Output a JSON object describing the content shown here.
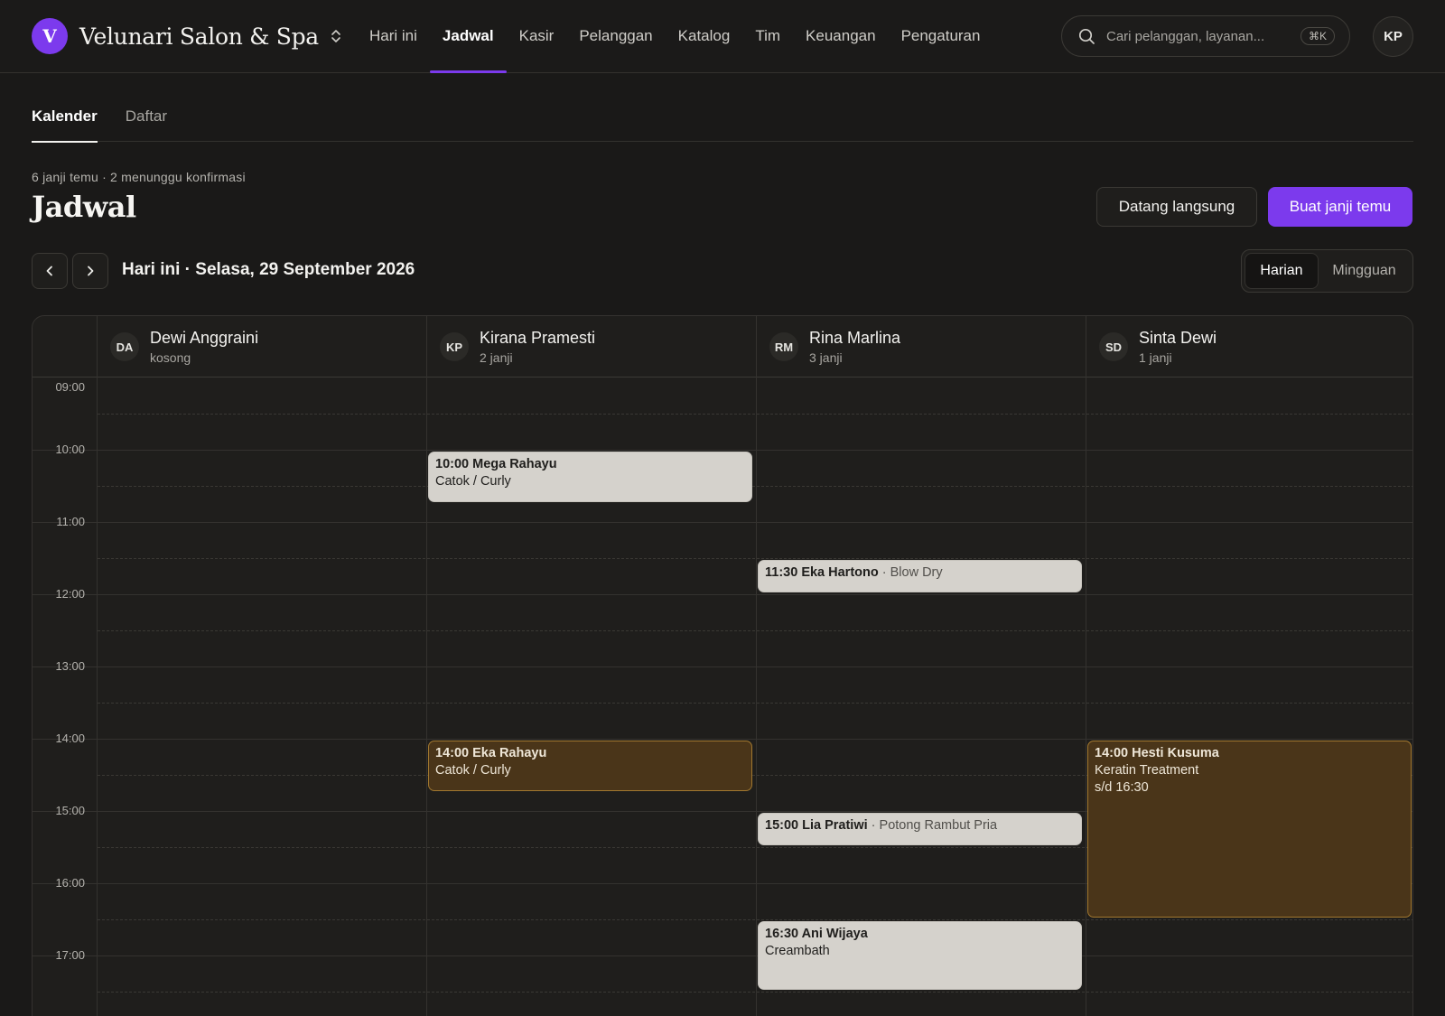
{
  "brand": {
    "initial": "V",
    "name": "Velunari Salon & Spa"
  },
  "nav": [
    {
      "label": "Hari ini",
      "active": false
    },
    {
      "label": "Jadwal",
      "active": true
    },
    {
      "label": "Kasir",
      "active": false
    },
    {
      "label": "Pelanggan",
      "active": false
    },
    {
      "label": "Katalog",
      "active": false
    },
    {
      "label": "Tim",
      "active": false
    },
    {
      "label": "Keuangan",
      "active": false
    },
    {
      "label": "Pengaturan",
      "active": false
    }
  ],
  "search": {
    "placeholder": "Cari pelanggan, layanan...",
    "shortcut": "⌘K"
  },
  "user": {
    "initials": "KP"
  },
  "subtabs": [
    {
      "label": "Kalender",
      "active": true
    },
    {
      "label": "Daftar",
      "active": false
    }
  ],
  "header": {
    "summary": "6 janji temu · 2 menunggu konfirmasi",
    "title": "Jadwal",
    "walk_in_label": "Datang langsung",
    "new_appointment_label": "Buat janji temu"
  },
  "date_nav": {
    "label": "Hari ini · Selasa, 29 September 2026"
  },
  "view_toggle": {
    "daily": "Harian",
    "weekly": "Mingguan",
    "active": "daily"
  },
  "calendar": {
    "hours": [
      "09:00",
      "10:00",
      "11:00",
      "12:00",
      "13:00",
      "14:00",
      "15:00",
      "16:00",
      "17:00"
    ],
    "staff": [
      {
        "initials": "DA",
        "name": "Dewi Anggraini",
        "count": "kosong"
      },
      {
        "initials": "KP",
        "name": "Kirana Pramesti",
        "count": "2 janji"
      },
      {
        "initials": "RM",
        "name": "Rina Marlina",
        "count": "3 janji"
      },
      {
        "initials": "SD",
        "name": "Sinta Dewi",
        "count": "1 janji"
      }
    ],
    "appointments": [
      {
        "staff_index": 1,
        "start": "10:00",
        "end": "10:45",
        "title": "10:00 Mega Rahayu",
        "service": "Catok / Curly",
        "status": "confirmed",
        "layout": "stacked"
      },
      {
        "staff_index": 2,
        "start": "11:30",
        "end": "12:00",
        "title": "11:30 Eka Hartono",
        "service": "Blow Dry",
        "status": "confirmed",
        "layout": "inline"
      },
      {
        "staff_index": 1,
        "start": "14:00",
        "end": "14:45",
        "title": "14:00 Eka Rahayu",
        "service": "Catok / Curly",
        "status": "pending",
        "layout": "stacked"
      },
      {
        "staff_index": 3,
        "start": "14:00",
        "end": "16:30",
        "title": "14:00 Hesti Kusuma",
        "service": "Keratin Treatment",
        "until": "s/d 16:30",
        "status": "pending",
        "layout": "stacked"
      },
      {
        "staff_index": 2,
        "start": "15:00",
        "end": "15:30",
        "title": "15:00 Lia Pratiwi",
        "service": "Potong Rambut Pria",
        "status": "confirmed",
        "layout": "inline"
      },
      {
        "staff_index": 2,
        "start": "16:30",
        "end": "17:30",
        "title": "16:30 Ani Wijaya",
        "service": "Creambath",
        "status": "confirmed",
        "layout": "stacked"
      }
    ]
  },
  "colors": {
    "accent": "#7c3aed",
    "background": "#1a1918",
    "appointment_confirmed": "#d5d2cc",
    "appointment_pending": "#4a3519",
    "appointment_pending_border": "#a2782f"
  },
  "icons": {
    "brand_switch": "chevron-up-down-icon",
    "search": "search-icon",
    "prev": "chevron-left-icon",
    "next": "chevron-right-icon"
  }
}
